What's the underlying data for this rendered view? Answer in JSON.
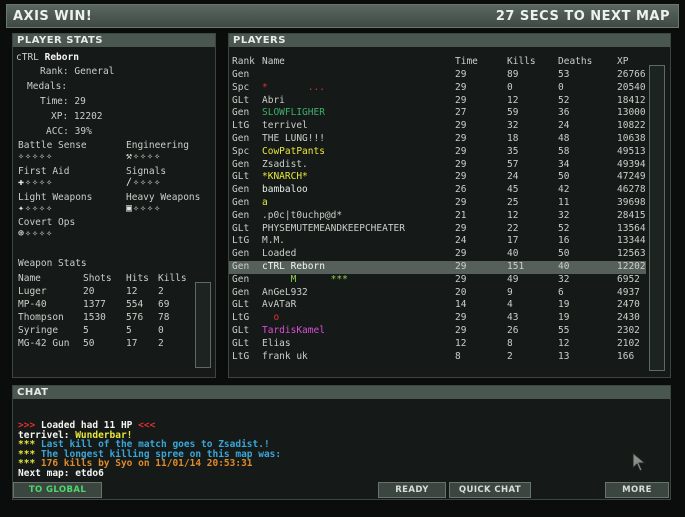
{
  "header": {
    "left": "AXIS WIN!",
    "right": "27 SECS TO NEXT MAP"
  },
  "player_stats": {
    "title": "PLAYER STATS",
    "name_prefix": "cTRL",
    "name_rest": " Reborn",
    "rank_label": "Rank:",
    "rank_value": "General",
    "medals_label": "Medals:",
    "time_label": "Time:",
    "time_value": "29",
    "xp_label": "XP:",
    "xp_value": "12202",
    "acc_label": "ACC:",
    "acc_value": "39%",
    "skills": [
      {
        "name": "Battle Sense",
        "icons": "✧✧✧✧✧"
      },
      {
        "name": "Engineering",
        "icons": "⚒✧✧✧✧"
      },
      {
        "name": "First Aid",
        "icons": "✚✧✧✧✧"
      },
      {
        "name": "Signals",
        "icons": "∕✧✧✧✧"
      },
      {
        "name": "Light Weapons",
        "icons": "✦✧✧✧✧"
      },
      {
        "name": "Heavy Weapons",
        "icons": "▣✧✧✧✧"
      },
      {
        "name": "Covert Ops",
        "icons": "⊕✧✧✧✧"
      }
    ],
    "weapon_stats_title": "Weapon Stats",
    "weapon_headers": [
      "Name",
      "Shots",
      "Hits",
      "Kills"
    ],
    "weapons": [
      [
        "Luger",
        "20",
        "12",
        "2"
      ],
      [
        "MP-40",
        "1377",
        "554",
        "69"
      ],
      [
        "Thompson",
        "1530",
        "576",
        "78"
      ],
      [
        "Syringe",
        "5",
        "5",
        "0"
      ],
      [
        "MG-42 Gun",
        "50",
        "17",
        "2"
      ]
    ]
  },
  "players": {
    "title": "PLAYERS",
    "headers": [
      "Rank",
      "Name",
      "Time",
      "Kills",
      "Deaths",
      "XP"
    ],
    "rows": [
      {
        "rank": "Gen",
        "name": "",
        "time": "29",
        "kills": "89",
        "deaths": "53",
        "xp": "26766",
        "color": "#c9cfc9"
      },
      {
        "rank": "Spc",
        "name": "*       ...",
        "time": "29",
        "kills": "0",
        "deaths": "0",
        "xp": "20540",
        "color": "#e03030"
      },
      {
        "rank": "GLt",
        "name": "Abri",
        "time": "29",
        "kills": "12",
        "deaths": "52",
        "xp": "18412",
        "color": "#c9cfc9"
      },
      {
        "rank": "Gen",
        "name": "SLOWFLIGHER",
        "time": "27",
        "kills": "59",
        "deaths": "36",
        "xp": "13000",
        "color": "#3fae6a"
      },
      {
        "rank": "LtG",
        "name": "terrivel",
        "time": "29",
        "kills": "32",
        "deaths": "24",
        "xp": "10822",
        "color": "#c9cfc9"
      },
      {
        "rank": "Gen",
        "name": "THE LUNG!!!",
        "time": "29",
        "kills": "18",
        "deaths": "48",
        "xp": "10638",
        "color": "#c9cfc9"
      },
      {
        "rank": "Spc",
        "name": "CowPatPants",
        "time": "29",
        "kills": "35",
        "deaths": "58",
        "xp": "49513",
        "color": "#e8e83a"
      },
      {
        "rank": "Gen",
        "name": "Zsadist.",
        "time": "29",
        "kills": "57",
        "deaths": "34",
        "xp": "49394",
        "color": "#c9cfc9"
      },
      {
        "rank": "GLt",
        "name": "*KNARCH*",
        "time": "29",
        "kills": "24",
        "deaths": "50",
        "xp": "47249",
        "color": "#e8e83a"
      },
      {
        "rank": "Gen",
        "name": "bambaloo",
        "time": "26",
        "kills": "45",
        "deaths": "42",
        "xp": "46278",
        "color": "#e6ece6"
      },
      {
        "rank": "Gen",
        "name": "a",
        "time": "29",
        "kills": "25",
        "deaths": "11",
        "xp": "39698",
        "color": "#e8e83a"
      },
      {
        "rank": "Gen",
        "name": ".p0c|t0uchp@d*",
        "time": "21",
        "kills": "12",
        "deaths": "32",
        "xp": "28415",
        "color": "#c9cfc9"
      },
      {
        "rank": "GLt",
        "name": "PHYSEMUTEMEANDKEEPCHEATER",
        "time": "29",
        "kills": "22",
        "deaths": "52",
        "xp": "13564",
        "color": "#c9cfc9"
      },
      {
        "rank": "LtG",
        "name": "M.M.",
        "time": "24",
        "kills": "17",
        "deaths": "16",
        "xp": "13344",
        "color": "#c9cfc9"
      },
      {
        "rank": "Gen",
        "name": "Loaded",
        "time": "29",
        "kills": "40",
        "deaths": "50",
        "xp": "12563",
        "color": "#c9cfc9"
      },
      {
        "rank": "Gen",
        "name": "cTRL Reborn",
        "time": "29",
        "kills": "151",
        "deaths": "40",
        "xp": "12202",
        "color": "#f2f5f2",
        "selected": true
      },
      {
        "rank": "Gen",
        "name": "     M      ***",
        "time": "29",
        "kills": "49",
        "deaths": "32",
        "xp": "6952",
        "color": "#8fd14f"
      },
      {
        "rank": "Gen",
        "name": "AnGeL932",
        "time": "20",
        "kills": "9",
        "deaths": "6",
        "xp": "4937",
        "color": "#c9cfc9"
      },
      {
        "rank": "GLt",
        "name": "AvATaR",
        "time": "14",
        "kills": "4",
        "deaths": "19",
        "xp": "2470",
        "color": "#c9cfc9"
      },
      {
        "rank": "LtG",
        "name": "  o",
        "time": "29",
        "kills": "43",
        "deaths": "19",
        "xp": "2430",
        "color": "#e03030"
      },
      {
        "rank": "GLt",
        "name": "TardisKamel",
        "time": "29",
        "kills": "26",
        "deaths": "55",
        "xp": "2302",
        "color": "#d84fd8"
      },
      {
        "rank": "GLt",
        "name": "Elias",
        "time": "12",
        "kills": "8",
        "deaths": "12",
        "xp": "2102",
        "color": "#c9cfc9"
      },
      {
        "rank": "LtG",
        "name": "frank uk",
        "time": "8",
        "kills": "2",
        "deaths": "13",
        "xp": "166",
        "color": "#c9cfc9"
      }
    ]
  },
  "chat": {
    "title": "CHAT",
    "lines": [
      {
        "prefix": ">>> ",
        "prefix_color": "#e03030",
        "text": "Loaded had 11 HP",
        "text_color": "#f2f5f2",
        "suffix": " <<<",
        "suffix_color": "#e03030"
      },
      {
        "prefix": "terrivel: ",
        "prefix_color": "#f2f5f2",
        "text": "Wunderbar!",
        "text_color": "#e8e83a",
        "suffix": "",
        "suffix_color": "#f2f5f2"
      },
      {
        "prefix": "*** ",
        "prefix_color": "#e8e83a",
        "text": "Last kill of the match goes to Zsadist.!",
        "text_color": "#3aa6d8",
        "suffix": "",
        "suffix_color": "#f2f5f2"
      },
      {
        "prefix": "*** ",
        "prefix_color": "#e8e83a",
        "text": "The longest killing spree on this map was:",
        "text_color": "#3aa6d8",
        "suffix": "",
        "suffix_color": "#f2f5f2"
      },
      {
        "prefix": "*** ",
        "prefix_color": "#e8e83a",
        "text": "176 kills by Syo on 11/01/14 20:53:31",
        "text_color": "#e08a2a",
        "suffix": "",
        "suffix_color": "#f2f5f2"
      },
      {
        "prefix": "",
        "prefix_color": "#f2f5f2",
        "text": "Next map: etdo6",
        "text_color": "#f2f5f2",
        "suffix": "",
        "suffix_color": "#f2f5f2"
      }
    ]
  },
  "buttons": {
    "global": "TO GLOBAL",
    "ready": "READY",
    "quick_chat": "QUICK CHAT",
    "more": "MORE"
  }
}
